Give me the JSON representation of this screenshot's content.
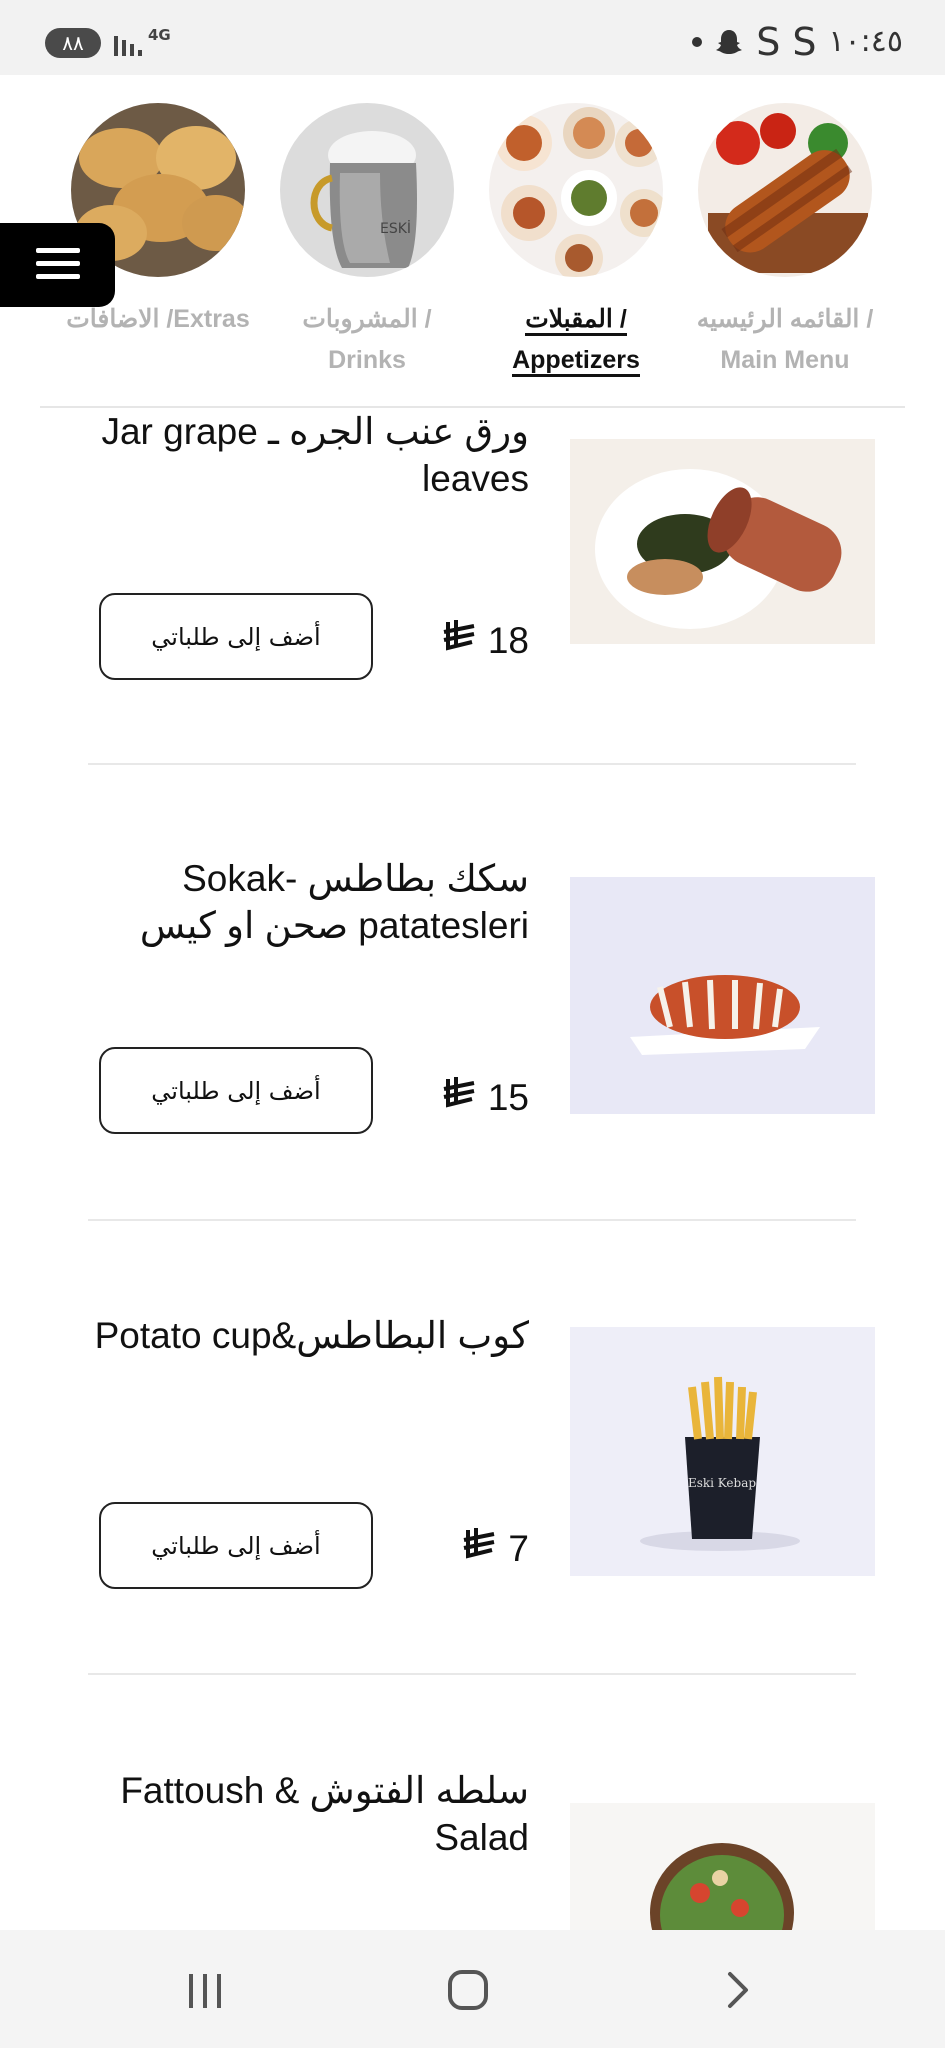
{
  "status_bar": {
    "battery": "٨٨",
    "network": "4G",
    "clock": "١٠:٤٥",
    "icons": [
      "dot-icon",
      "snapchat-icon",
      "s-icon",
      "s-icon"
    ]
  },
  "categories": [
    {
      "label": "القائمه الرئيسيه / Main Menu",
      "icon": "wrap-image",
      "active": false
    },
    {
      "label": "المقبلات / Appetizers",
      "icon": "appetizers-image",
      "active": true
    },
    {
      "label": "المشروبات / Drinks",
      "icon": "drink-pot-image",
      "active": false
    },
    {
      "label": "الاضافات /Extras",
      "icon": "bread-image",
      "active": false
    }
  ],
  "items": [
    {
      "name": "ورق عنب الجره ـ Jar grape leaves",
      "price": "18",
      "button": "أضف إلى طلباتي",
      "image": "grape-leaves-image"
    },
    {
      "name": "سكك بطاطس -Sokak patatesleri صحن او كيس",
      "price": "15",
      "button": "أضف إلى طلباتي",
      "image": "sokak-potato-image"
    },
    {
      "name": "كوب البطاطس&Potato cup",
      "price": "7",
      "button": "أضف إلى طلباتي",
      "image": "potato-cup-image"
    },
    {
      "name": "سلطه الفتوش & Fattoush Salad",
      "image": "fattoush-salad-image"
    }
  ],
  "nav": {
    "icons": [
      "recents-icon",
      "home-icon",
      "back-icon"
    ]
  }
}
